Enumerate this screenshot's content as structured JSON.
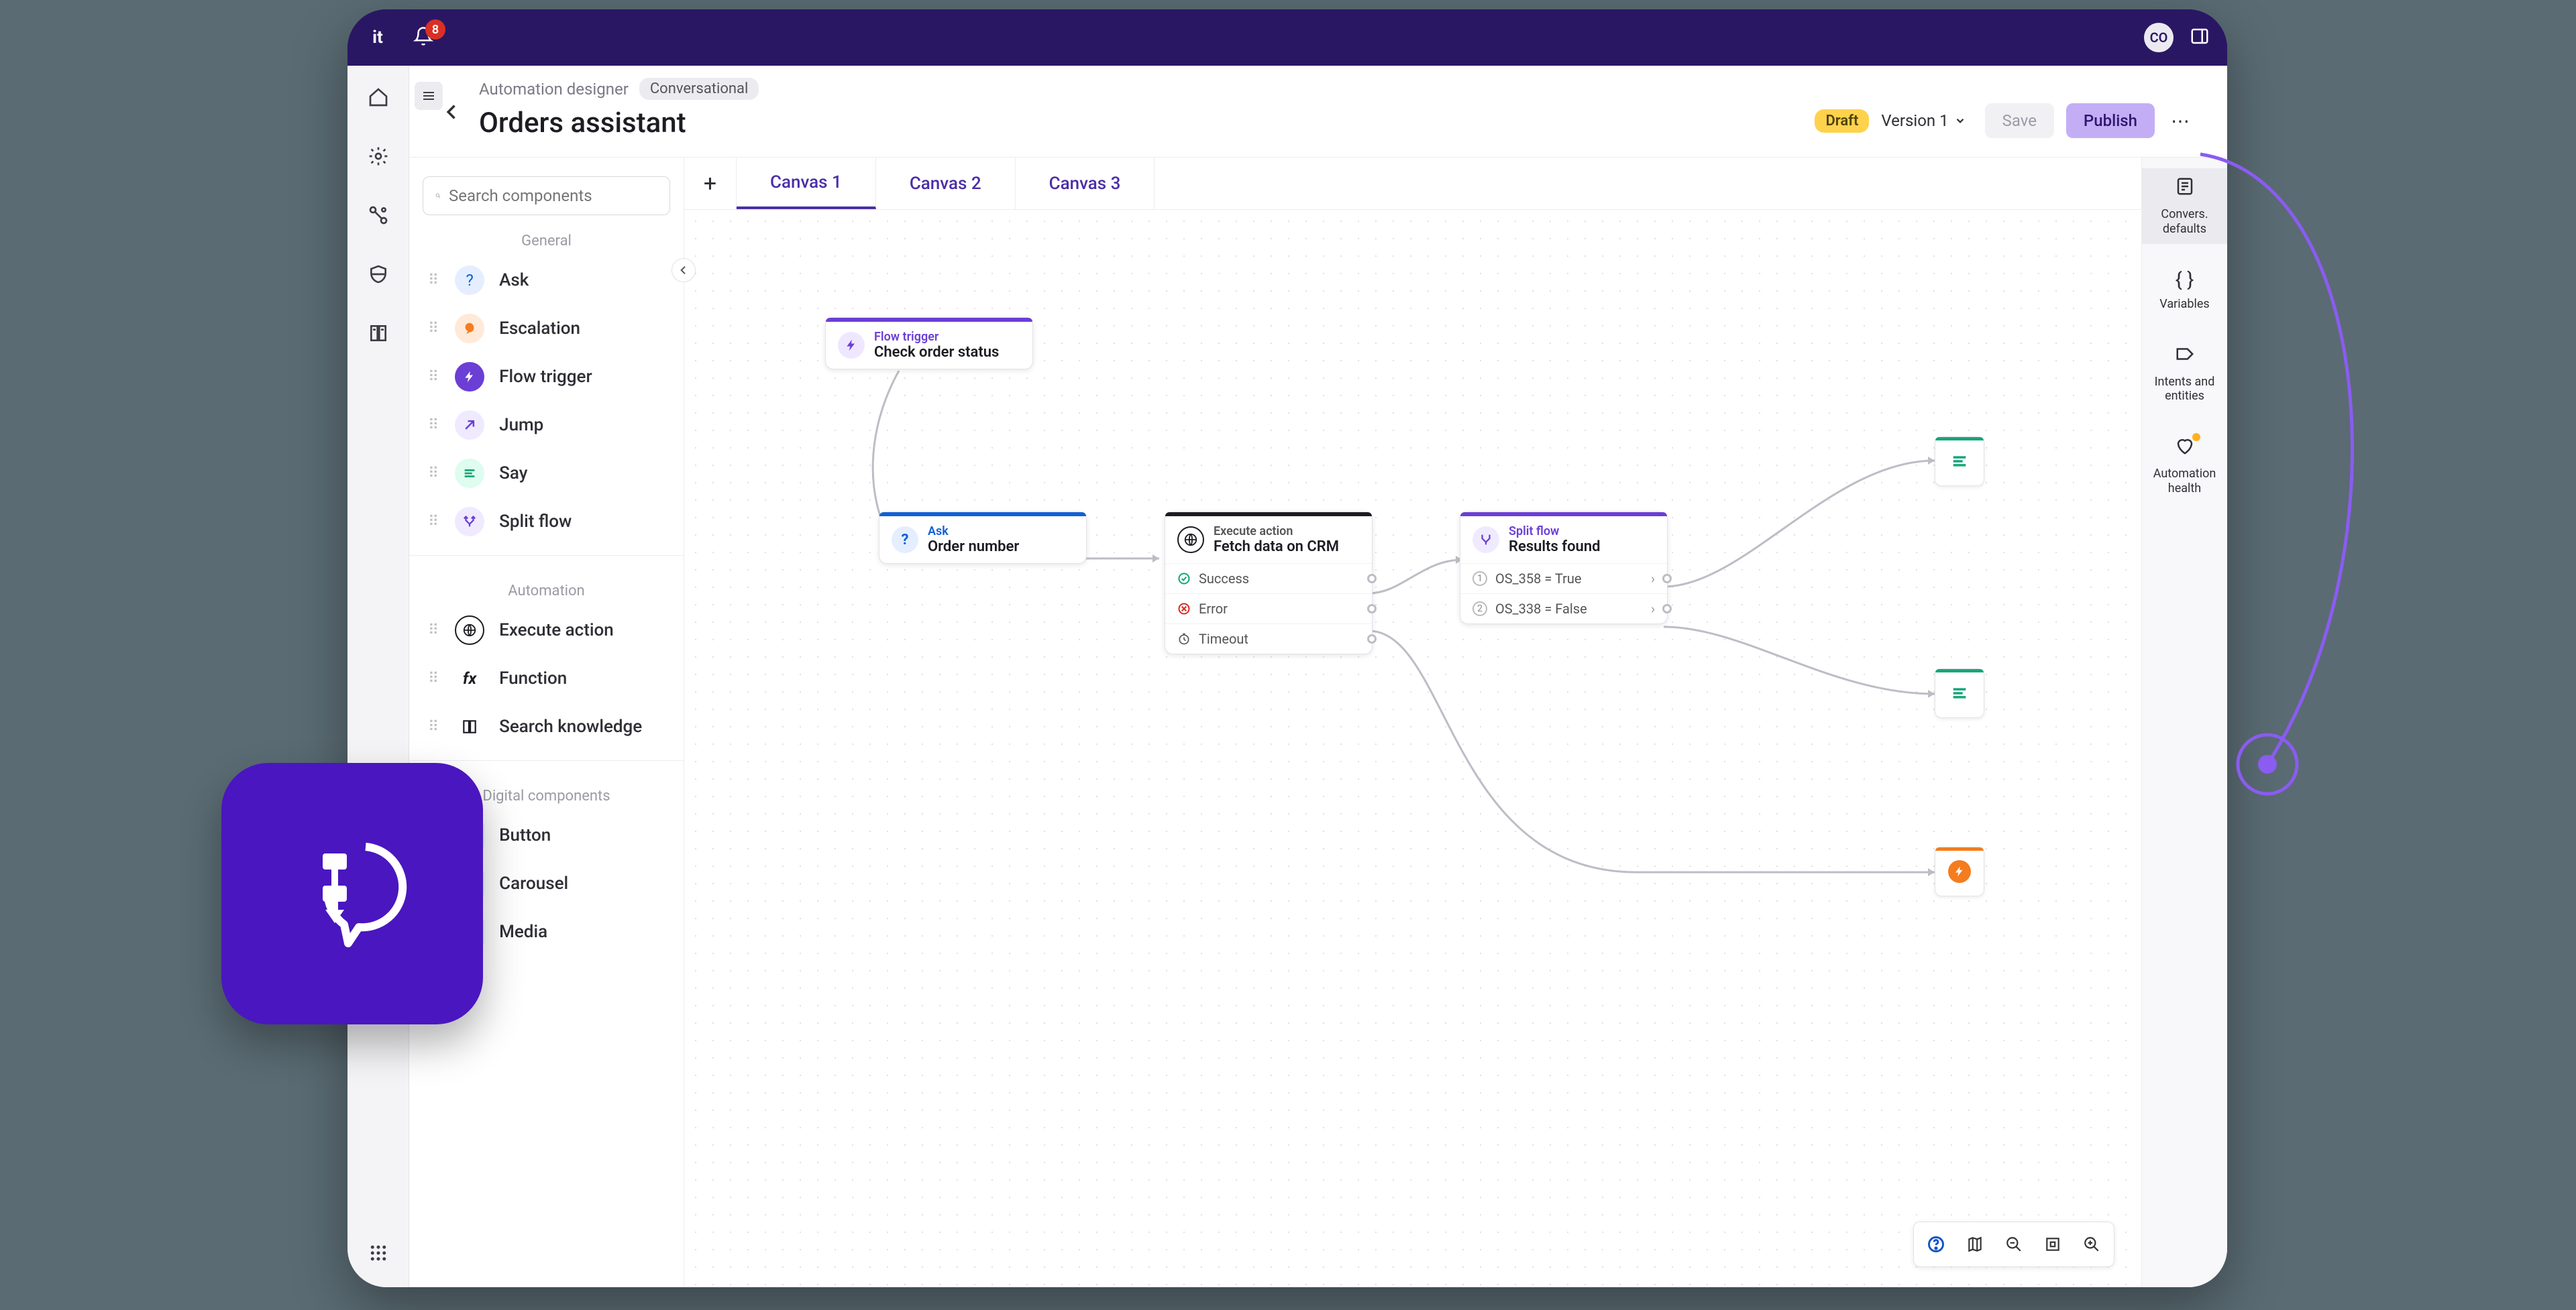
{
  "titlebar": {
    "logo": "it",
    "notif_count": "8",
    "avatar": "CO"
  },
  "breadcrumbs": {
    "a": "Automation designer",
    "b": "Conversational"
  },
  "page_title": "Orders assistant",
  "status": {
    "draft": "Draft",
    "version": "Version 1"
  },
  "actions": {
    "save": "Save",
    "publish": "Publish"
  },
  "search": {
    "placeholder": "Search components"
  },
  "palette": {
    "sections": {
      "general": "General",
      "automation": "Automation",
      "digital": "Digital components"
    },
    "items": {
      "ask": "Ask",
      "escalation": "Escalation",
      "flow_trigger": "Flow trigger",
      "jump": "Jump",
      "say": "Say",
      "split_flow": "Split flow",
      "execute_action": "Execute action",
      "function": "Function",
      "search_knowledge": "Search knowledge",
      "button": "Button",
      "carousel": "Carousel",
      "media": "Media"
    }
  },
  "tabs": {
    "c1": "Canvas 1",
    "c2": "Canvas 2",
    "c3": "Canvas 3"
  },
  "right_rail": {
    "convers": "Convers. defaults",
    "variables": "Variables",
    "intents": "Intents and entities",
    "health": "Automation health"
  },
  "nodes": {
    "trigger": {
      "kind": "Flow trigger",
      "title": "Check order status"
    },
    "ask": {
      "kind": "Ask",
      "title": "Order number"
    },
    "exec": {
      "kind": "Execute action",
      "title": "Fetch data on CRM",
      "r1": "Success",
      "r2": "Error",
      "r3": "Timeout"
    },
    "split": {
      "kind": "Split flow",
      "title": "Results found",
      "r1": "OS_358 = True",
      "r2": "OS_338 = False"
    }
  },
  "colors": {
    "purple": "#6b3ed6",
    "blue": "#1060d6",
    "green": "#17a67a",
    "orange": "#f57c1f",
    "red": "#d93025",
    "black": "#1c1c22"
  }
}
